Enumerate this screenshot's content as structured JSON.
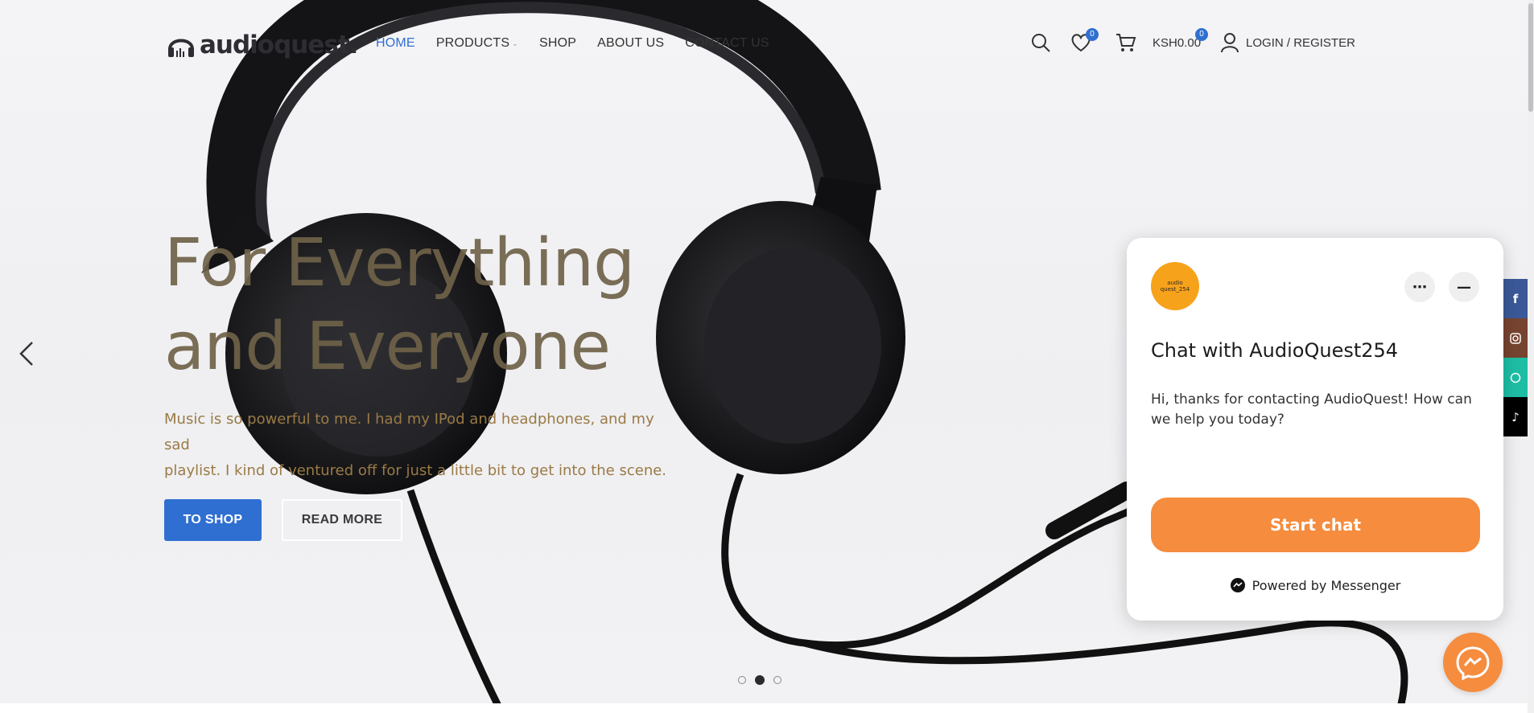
{
  "brand": {
    "logo_text": "audioquest."
  },
  "nav": {
    "items": [
      {
        "label": "HOME"
      },
      {
        "label": "PRODUCTS"
      },
      {
        "label": "SHOP"
      },
      {
        "label": "ABOUT US"
      },
      {
        "label": "CONTACT US"
      }
    ]
  },
  "header_tools": {
    "wishlist_count": "0",
    "cart_count": "0",
    "cart_total": "KSH0.00",
    "login_label": "LOGIN / REGISTER"
  },
  "hero": {
    "headline_line1": "For Everything",
    "headline_line2": "and Everyone",
    "subtext_line1": "Music is so powerful to me. I had my IPod and headphones, and my sad",
    "subtext_line2": "playlist. I kind of ventured off for just a little bit to get into the scene.",
    "primary_button": "TO SHOP",
    "secondary_button": "READ MORE",
    "slide_count": 3,
    "active_slide": 2
  },
  "chat_widget": {
    "avatar_text_line1": "audio",
    "avatar_text_line2": "quest_254",
    "title": "Chat with AudioQuest254",
    "message": "Hi, thanks for contacting AudioQuest! How can we help you today?",
    "start_button": "Start chat",
    "powered_by": "Powered by Messenger"
  },
  "social": [
    {
      "name": "facebook-icon",
      "color": "#3b5998"
    },
    {
      "name": "instagram-icon",
      "color": "#774430"
    },
    {
      "name": "whatsapp-icon",
      "color": "#1ebea5"
    },
    {
      "name": "tiktok-icon",
      "color": "#000000"
    }
  ],
  "colors": {
    "accent_blue": "#2f6fd1",
    "chat_orange": "#f58c3e",
    "headline": "#6f6249",
    "subtext": "#9a7a45"
  }
}
